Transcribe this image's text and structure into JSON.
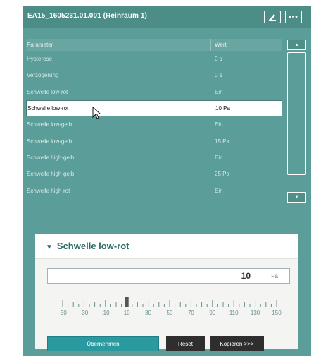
{
  "window": {
    "title": "EA15_1605231.01.001 (Reinraum 1)"
  },
  "table": {
    "col_parameter": "Parameter",
    "col_value": "Wert",
    "rows": [
      {
        "param": "Hysterese",
        "value": "0 s"
      },
      {
        "param": "Verzögerung",
        "value": "0 s"
      },
      {
        "param": "Schwelle low-rot",
        "value": "Ein"
      },
      {
        "param": "Schwelle low-rot",
        "value": "10 Pa"
      },
      {
        "param": "Schwelle low-gelb",
        "value": "Ein"
      },
      {
        "param": "Schwelle low-gelb",
        "value": "15 Pa"
      },
      {
        "param": "Schwelle high-gelb",
        "value": "Ein"
      },
      {
        "param": "Schwelle high-gelb",
        "value": "25 Pa"
      },
      {
        "param": "Schwelle high-rot",
        "value": "Ein"
      }
    ],
    "selected_index": 3
  },
  "editor": {
    "title": "Schwelle low-rot",
    "value": "10",
    "unit": "Pa",
    "slider": {
      "min": -50,
      "max": 150,
      "current": 10,
      "tick_labels": [
        "-50",
        "-30",
        "-10",
        "10",
        "30",
        "50",
        "70",
        "90",
        "110",
        "130",
        "150"
      ]
    },
    "apply_label": "Übernehmen",
    "reset_label": "Reset",
    "copy_label": "Kopieren >>>"
  },
  "icons": {
    "edit": "edit-icon",
    "more": "more-icon",
    "scroll_up": "chevron-up-icon",
    "scroll_down": "chevron-down-icon",
    "collapse": "triangle-down-icon"
  },
  "colors": {
    "window_bg": "#5b9d98",
    "title_bg": "#4d8d88",
    "accent": "#2b9aa0",
    "panel_title": "#2d6b67"
  }
}
